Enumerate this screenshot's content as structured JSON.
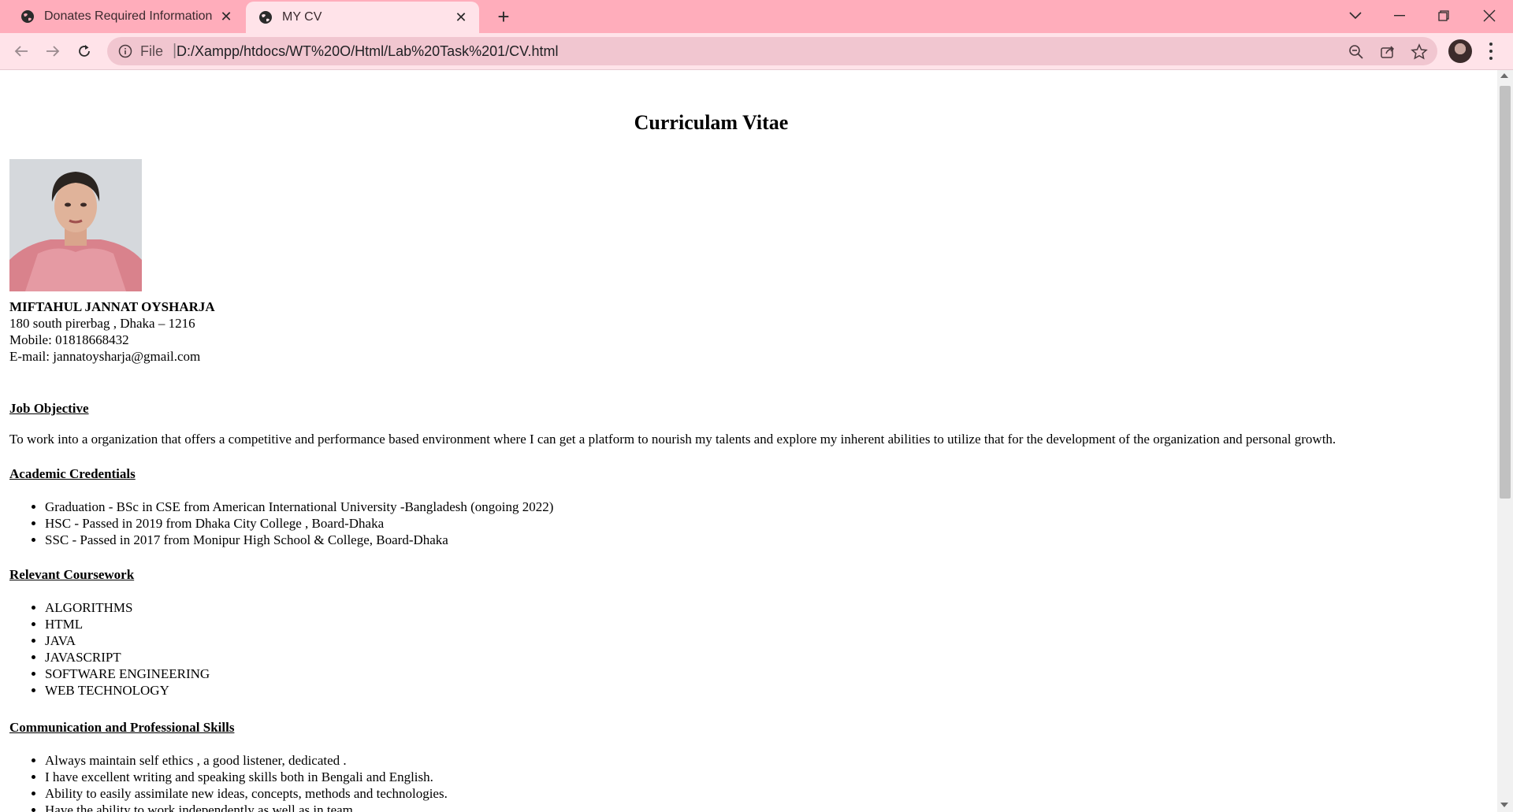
{
  "browser": {
    "tabs": [
      {
        "title": "Donates Required Information",
        "icon": "globe-icon"
      },
      {
        "title": "MY CV",
        "icon": "globe-icon",
        "active": true
      }
    ],
    "address": {
      "scheme": "File",
      "url": "D:/Xampp/htdocs/WT%20O/Html/Lab%20Task%201/CV.html"
    },
    "colors": {
      "tab_strip": "#ffadbb",
      "toolbar": "#ffe3e9",
      "omnibox": "#f1c6d0"
    }
  },
  "cv": {
    "heading": "Curriculam Vitae",
    "name": "MIFTAHUL JANNAT OYSHARJA",
    "address": "180 south pirerbag , Dhaka – 1216",
    "mobile": "Mobile: 01818668432",
    "email": "E-mail: jannatoysharja@gmail.com",
    "sections": {
      "job_objective": {
        "title": "Job Objective",
        "text": "To work into a organization that offers a competitive and performance based environment where I can get a platform to nourish my talents and explore my inherent abilities to utilize that for the development of the organization and personal growth."
      },
      "academic": {
        "title": "Academic Credentials",
        "items": [
          "Graduation - BSc in CSE from American International University -Bangladesh (ongoing 2022)",
          "HSC - Passed in 2019 from Dhaka City College , Board-Dhaka",
          "SSC - Passed in 2017 from Monipur High School & College, Board-Dhaka"
        ]
      },
      "coursework": {
        "title": "Relevant Coursework",
        "items": [
          "ALGORITHMS",
          "HTML",
          "JAVA",
          "JAVASCRIPT",
          "SOFTWARE ENGINEERING",
          "WEB TECHNOLOGY"
        ]
      },
      "skills": {
        "title": "Communication and Professional Skills",
        "items": [
          "Always maintain self ethics , a good listener, dedicated .",
          "I have excellent writing and speaking skills both in Bengali and English.",
          "Ability to easily assimilate new ideas, concepts, methods and technologies.",
          "Have the ability to work independently as well as in team."
        ]
      }
    }
  }
}
